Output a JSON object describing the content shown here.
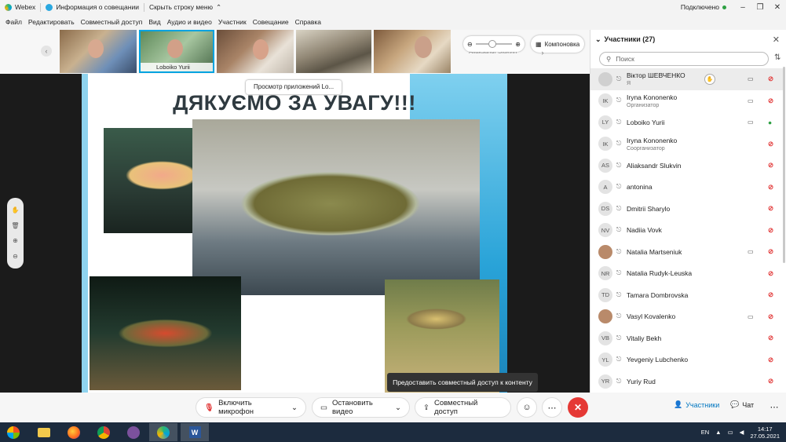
{
  "window": {
    "app_title": "Webex",
    "tab_title": "Информация о совещании",
    "hide_menu": "Скрыть строку меню",
    "status": "Подключено"
  },
  "menu": [
    "Файл",
    "Редактировать",
    "Совместный доступ",
    "Вид",
    "Аудио и видео",
    "Участник",
    "Совещание",
    "Справка"
  ],
  "strip": {
    "thumb_labels": [
      "",
      "Loboiko Yurii",
      "",
      "",
      "",
      "Aliaksandr Slukvin"
    ],
    "layout_label": "Компоновка"
  },
  "slide": {
    "title": "ДЯКУЄМО ЗА УВАГУ!!!",
    "preview_label": "Просмотр приложений Lo...",
    "tooltip": "Предоставить совместный доступ к контенту"
  },
  "participants": {
    "header": "Участники (27)",
    "search_placeholder": "Поиск",
    "items": [
      {
        "initials": "",
        "name": "Віктор ШЕВЧЕНКО",
        "role": "Я",
        "camera": true,
        "mic_on": false,
        "hand": true,
        "photo": false
      },
      {
        "initials": "IK",
        "name": "Iryna Kononenko",
        "role": "Организатор",
        "camera": true,
        "mic_on": false,
        "hand": false,
        "photo": false
      },
      {
        "initials": "LY",
        "name": "Loboiko Yurii",
        "role": "",
        "camera": true,
        "mic_on": true,
        "hand": false,
        "photo": false
      },
      {
        "initials": "IK",
        "name": "Iryna Kononenko",
        "role": "Соорганизатор",
        "camera": false,
        "mic_on": false,
        "hand": false,
        "photo": false
      },
      {
        "initials": "AS",
        "name": "Aliaksandr Slukvin",
        "role": "",
        "camera": false,
        "mic_on": false,
        "hand": false,
        "photo": false
      },
      {
        "initials": "A",
        "name": "antonina",
        "role": "",
        "camera": false,
        "mic_on": false,
        "hand": false,
        "photo": false
      },
      {
        "initials": "DS",
        "name": "Dmitrii Sharylo",
        "role": "",
        "camera": false,
        "mic_on": false,
        "hand": false,
        "photo": false
      },
      {
        "initials": "NV",
        "name": "Nadiia Vovk",
        "role": "",
        "camera": false,
        "mic_on": false,
        "hand": false,
        "photo": false
      },
      {
        "initials": "",
        "name": "Natalia Martseniuk",
        "role": "",
        "camera": true,
        "mic_on": false,
        "hand": false,
        "photo": true
      },
      {
        "initials": "NR",
        "name": "Natalia Rudyk-Leuska",
        "role": "",
        "camera": false,
        "mic_on": false,
        "hand": false,
        "photo": false
      },
      {
        "initials": "TD",
        "name": "Tamara Dombrovska",
        "role": "",
        "camera": false,
        "mic_on": false,
        "hand": false,
        "photo": false
      },
      {
        "initials": "",
        "name": "Vasyl Kovalenko",
        "role": "",
        "camera": true,
        "mic_on": false,
        "hand": false,
        "photo": true
      },
      {
        "initials": "VB",
        "name": "Vitaliy Bekh",
        "role": "",
        "camera": false,
        "mic_on": false,
        "hand": false,
        "photo": false
      },
      {
        "initials": "YL",
        "name": "Yevgeniy Lubchenko",
        "role": "",
        "camera": false,
        "mic_on": false,
        "hand": false,
        "photo": false
      },
      {
        "initials": "YR",
        "name": "Yuriy Rud",
        "role": "",
        "camera": false,
        "mic_on": false,
        "hand": false,
        "photo": false
      }
    ]
  },
  "controls": {
    "mic": "Включить микрофон",
    "video": "Остановить видео",
    "share": "Совместный доступ",
    "participants_tab": "Участники",
    "chat_tab": "Чат"
  },
  "taskbar": {
    "lang": "EN",
    "time": "14:17",
    "date": "27.05.2021"
  },
  "colors": {
    "accent": "#00a3e0",
    "end_call": "#e53935",
    "mic_muted": "#e23a3a",
    "mic_on": "#2ea043",
    "slide_blue": "#29a3d8"
  }
}
